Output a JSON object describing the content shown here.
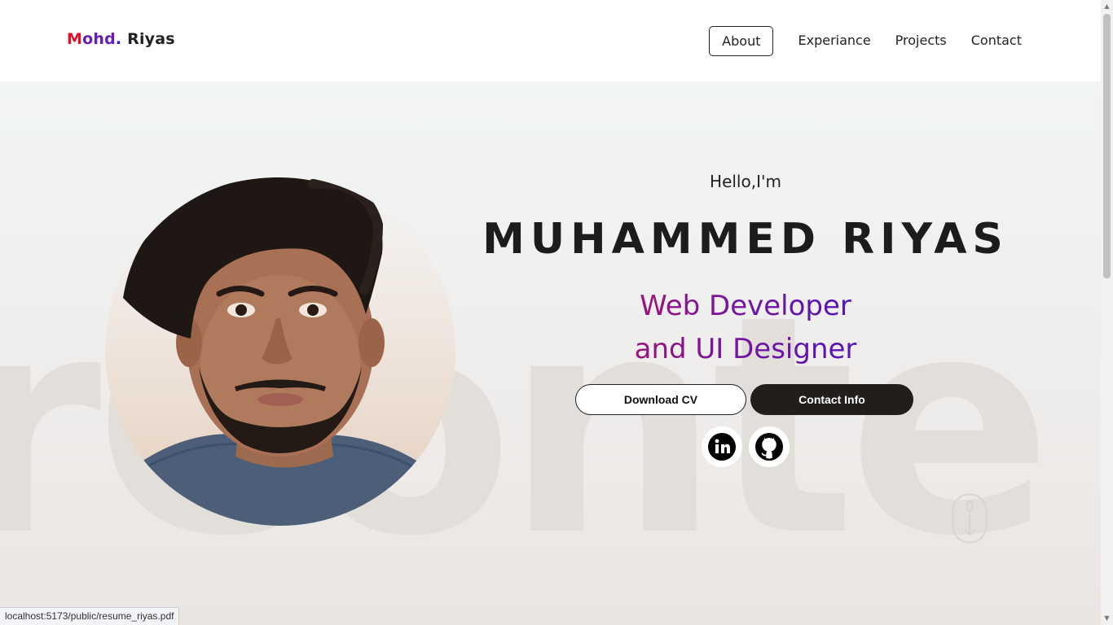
{
  "header": {
    "logo": {
      "part1": "M",
      "part2": "ohd",
      "dot": ".",
      "part3": " Riyas"
    },
    "nav": [
      {
        "label": "About"
      },
      {
        "label": "Experiance"
      },
      {
        "label": "Projects"
      },
      {
        "label": "Contact"
      }
    ]
  },
  "hero": {
    "background_word": "rConte",
    "greeting": "Hello,I'm",
    "name": "MUHAMMED RIYAS",
    "role_line1": "Web Developer",
    "role_line2": "and UI Designer",
    "buttons": {
      "download_cv": "Download CV",
      "contact_info": "Contact Info"
    },
    "social_icons": [
      "linkedin-icon",
      "github-icon"
    ],
    "portrait": "profile-photo"
  },
  "status_bar": {
    "url": "localhost:5173/public/resume_riyas.pdf"
  },
  "colors": {
    "accent_red": "#e8102c",
    "accent_purple": "#7a159a",
    "accent_blue": "#2514e0",
    "dark": "#211e1c"
  }
}
